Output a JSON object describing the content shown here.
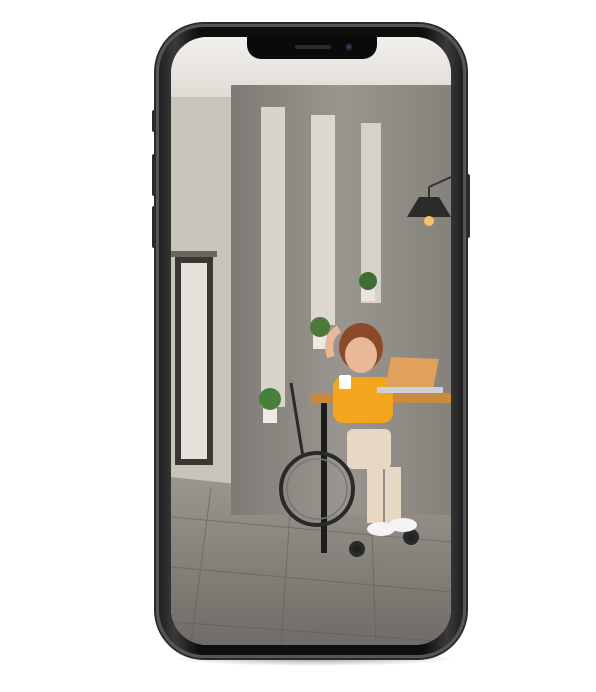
{
  "device": {
    "model": "smartphone-mockup",
    "frame_color": "#111111"
  },
  "screen": {
    "content": "photo",
    "palette": {
      "ceiling": "#e9e6e1",
      "wall_left": "#cfcac2",
      "concrete": "#8d8a84",
      "floor": "#7f7c76",
      "shirt": "#f2a51d",
      "desk": "#c9893e",
      "laptop": "#e0a15a"
    }
  },
  "icons": {
    "camera": "front-camera-icon",
    "speaker": "earpiece-speaker-icon"
  }
}
